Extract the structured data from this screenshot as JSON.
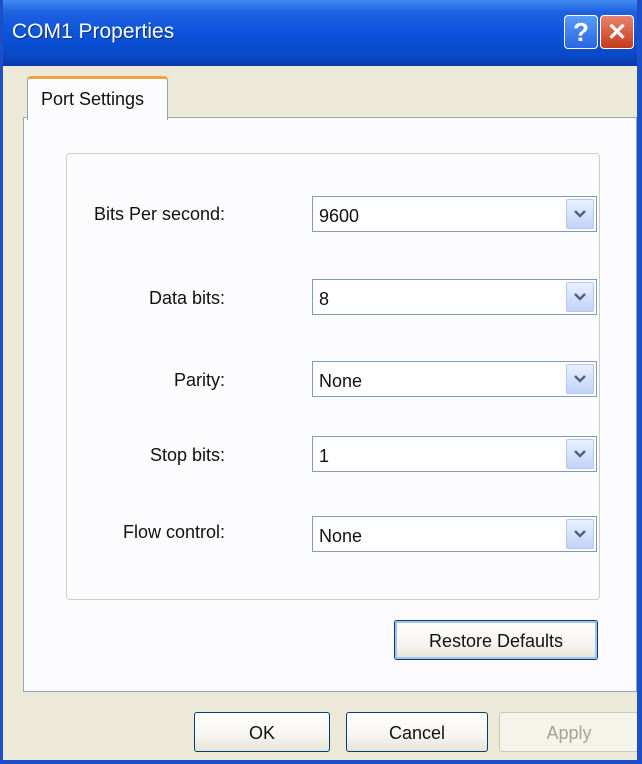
{
  "window": {
    "title": "COM1 Properties",
    "help_glyph": "?",
    "close_glyph": "✕"
  },
  "tabs": [
    {
      "label": "Port Settings",
      "selected": true
    }
  ],
  "fields": [
    {
      "label": "Bits Per second:",
      "value": "9600"
    },
    {
      "label": "Data bits:",
      "value": "8"
    },
    {
      "label": "Parity:",
      "value": "None"
    },
    {
      "label": "Stop bits:",
      "value": "1"
    },
    {
      "label": "Flow control:",
      "value": "None"
    }
  ],
  "restore_label": "Restore Defaults",
  "buttons": {
    "ok": "OK",
    "cancel": "Cancel",
    "apply": "Apply"
  },
  "icons": {
    "help": "question-mark-icon",
    "close": "close-icon",
    "dropdown": "chevron-down-icon"
  },
  "colors": {
    "titlebar": "#0b54dc",
    "dialog_face": "#ece9d8",
    "tab_accent": "#f3a23e",
    "close_button": "#c63a1c"
  }
}
